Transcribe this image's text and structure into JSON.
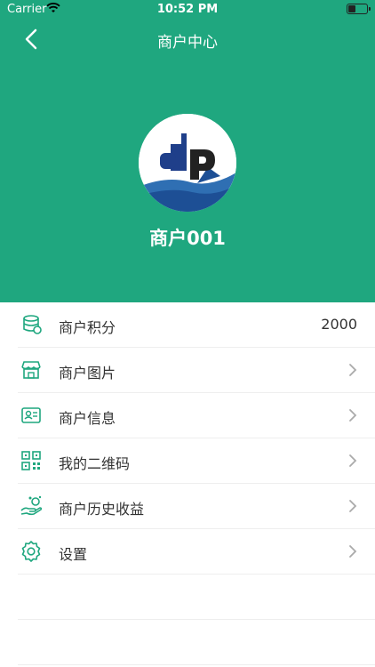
{
  "status_bar": {
    "carrier": "Carrier",
    "time": "10:52 PM"
  },
  "header": {
    "title": "商户中心",
    "merchant_name": "商户001"
  },
  "menu": [
    {
      "label": "商户积分",
      "value": "2000",
      "icon": "points-icon"
    },
    {
      "label": "商户图片",
      "icon": "store-icon"
    },
    {
      "label": "商户信息",
      "icon": "id-card-icon"
    },
    {
      "label": "我的二维码",
      "icon": "qrcode-icon"
    },
    {
      "label": "商户历史收益",
      "icon": "income-icon"
    },
    {
      "label": "设置",
      "icon": "gear-icon"
    }
  ],
  "colors": {
    "brand": "#1fa77f",
    "icon": "#1fa77f"
  }
}
